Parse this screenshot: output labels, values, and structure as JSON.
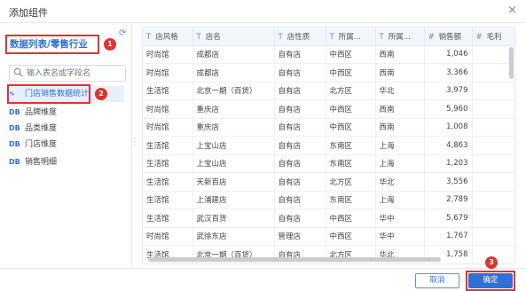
{
  "dialog": {
    "title": "添加组件",
    "close_glyph": "×"
  },
  "left": {
    "breadcrumb": "数据列表/零售行业",
    "search_placeholder": "输入表名或字段名",
    "items": [
      {
        "icon": "∿",
        "label": "门店销售数据统计",
        "active": true
      },
      {
        "icon": "DB",
        "label": "品牌维度"
      },
      {
        "icon": "DB",
        "label": "品类维度"
      },
      {
        "icon": "DB",
        "label": "门店维度"
      },
      {
        "icon": "DB",
        "label": "销售明细"
      }
    ]
  },
  "table": {
    "columns": [
      {
        "type": "T",
        "label": "店风格"
      },
      {
        "type": "T",
        "label": "店名"
      },
      {
        "type": "T",
        "label": "店性质"
      },
      {
        "type": "T",
        "label": "所属..."
      },
      {
        "type": "T",
        "label": "所属..."
      },
      {
        "type": "#",
        "label": "销售额"
      },
      {
        "type": "#",
        "label": "毛利"
      }
    ],
    "rows": [
      [
        "时尚馆",
        "成都店",
        "自有店",
        "中西区",
        "西南",
        "1,046",
        ""
      ],
      [
        "时尚馆",
        "成都店",
        "自有店",
        "中西区",
        "西南",
        "3,366",
        ""
      ],
      [
        "生活馆",
        "北京一期（百货）",
        "自有店",
        "北方区",
        "华北",
        "3,979",
        ""
      ],
      [
        "时尚馆",
        "重庆店",
        "自有店",
        "中西区",
        "西南",
        "5,960",
        ""
      ],
      [
        "时尚馆",
        "重庆店",
        "自有店",
        "中西区",
        "西南",
        "1,008",
        ""
      ],
      [
        "生活馆",
        "上宝山店",
        "自有店",
        "东南区",
        "上海",
        "4,863",
        ""
      ],
      [
        "生活馆",
        "上宝山店",
        "自有店",
        "东南区",
        "上海",
        "1,203",
        ""
      ],
      [
        "生活馆",
        "天新百店",
        "自有店",
        "北方区",
        "华北",
        "3,556",
        ""
      ],
      [
        "生活馆",
        "上浦建店",
        "自有店",
        "东南区",
        "上海",
        "2,789",
        ""
      ],
      [
        "生活馆",
        "武汉百货",
        "自有店",
        "中西区",
        "华中",
        "5,679",
        ""
      ],
      [
        "时尚馆",
        "武徐东店",
        "管理店",
        "中西区",
        "华中",
        "1,767",
        ""
      ],
      [
        "生活馆",
        "北京一期（百货）",
        "自有店",
        "北方区",
        "华北",
        "1,758",
        ""
      ]
    ]
  },
  "footer": {
    "cancel_label": "取消",
    "ok_label": "确定"
  },
  "annotations": [
    "1",
    "2",
    "3"
  ]
}
